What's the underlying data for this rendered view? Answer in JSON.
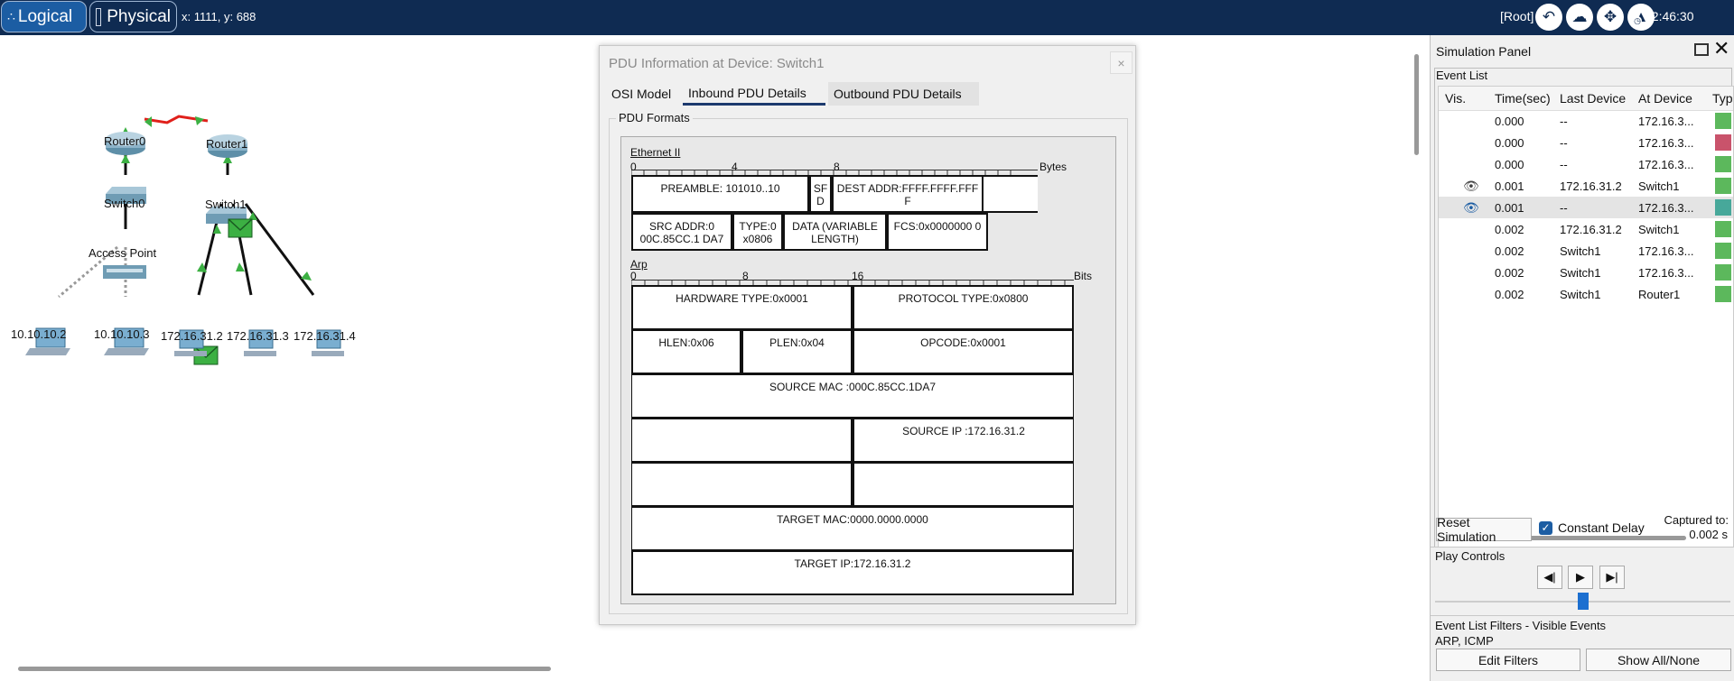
{
  "topbar": {
    "logical_label": "Logical",
    "physical_label": "Physical",
    "coordinates": "x: 1111, y: 688",
    "root_label": "[Root]",
    "clock": "12:46:30"
  },
  "devices": {
    "router0": "Router0",
    "router1": "Router1",
    "switch0": "Switch0",
    "switch1": "Switch1",
    "access_point": "Access Point",
    "pc1": "10.10.10.2",
    "pc2": "10.10.10.3",
    "pc3": "172.16.31.2",
    "pc4": "172.16.31.3",
    "pc5": "172.16.31.4"
  },
  "dialog": {
    "title": "PDU Information at Device: Switch1",
    "close": "×",
    "tabs": [
      "OSI Model",
      "Inbound PDU Details",
      "Outbound PDU Details"
    ],
    "active_tab": "Inbound PDU Details",
    "group_title": "PDU Formats",
    "ethernet": {
      "name": "Ethernet II",
      "scale": [
        "0",
        "4",
        "8"
      ],
      "unit": "Bytes",
      "preamble": "PREAMBLE: 101010..10",
      "sfd": "SF D",
      "dest": "DEST ADDR:FFFF.FFFF.FFF F",
      "src": "SRC ADDR:0 00C.85CC.1 DA7",
      "type": "TYPE:0 x0806",
      "data": "DATA (VARIABLE LENGTH)",
      "fcs": "FCS:0x0000000 0"
    },
    "arp": {
      "name": "Arp",
      "scale": [
        "0",
        "8",
        "16"
      ],
      "unit": "Bits",
      "hardware_type": "HARDWARE TYPE:0x0001",
      "protocol_type": "PROTOCOL TYPE:0x0800",
      "hlen": "HLEN:0x06",
      "plen": "PLEN:0x04",
      "opcode": "OPCODE:0x0001",
      "source_mac": "SOURCE MAC :000C.85CC.1DA7",
      "source_ip": "SOURCE IP :172.16.31.2",
      "target_mac": "TARGET MAC:0000.0000.0000",
      "target_ip": "TARGET IP:172.16.31.2"
    }
  },
  "sim_panel": {
    "title": "Simulation Panel",
    "event_list_label": "Event List",
    "columns": [
      "Vis.",
      "Time(sec)",
      "Last Device",
      "At Device",
      "Typ"
    ],
    "events": [
      {
        "time": "0.000",
        "last": "--",
        "at": "172.16.3...",
        "color": "#5cb85c",
        "eye": false
      },
      {
        "time": "0.000",
        "last": "--",
        "at": "172.16.3...",
        "color": "#c9536b",
        "eye": false
      },
      {
        "time": "0.000",
        "last": "--",
        "at": "172.16.3...",
        "color": "#5cb85c",
        "eye": false
      },
      {
        "time": "0.001",
        "last": "172.16.31.2",
        "at": "Switch1",
        "color": "#5cb85c",
        "eye": true
      },
      {
        "time": "0.001",
        "last": "--",
        "at": "172.16.3...",
        "color": "#47a89a",
        "eye": true
      },
      {
        "time": "0.002",
        "last": "172.16.31.2",
        "at": "Switch1",
        "color": "#5cb85c",
        "eye": false
      },
      {
        "time": "0.002",
        "last": "Switch1",
        "at": "172.16.3...",
        "color": "#5cb85c",
        "eye": false
      },
      {
        "time": "0.002",
        "last": "Switch1",
        "at": "172.16.3...",
        "color": "#5cb85c",
        "eye": false
      },
      {
        "time": "0.002",
        "last": "Switch1",
        "at": "Router1",
        "color": "#5cb85c",
        "eye": false
      }
    ],
    "reset_label": "Reset Simulation",
    "constant_delay_label": "Constant Delay",
    "captured_label": "Captured to:",
    "captured_value": "0.002 s",
    "play_controls_label": "Play Controls",
    "filters_label": "Event List Filters - Visible Events",
    "filters_value": "ARP, ICMP",
    "edit_filters_label": "Edit Filters",
    "show_all_label": "Show All/None"
  }
}
